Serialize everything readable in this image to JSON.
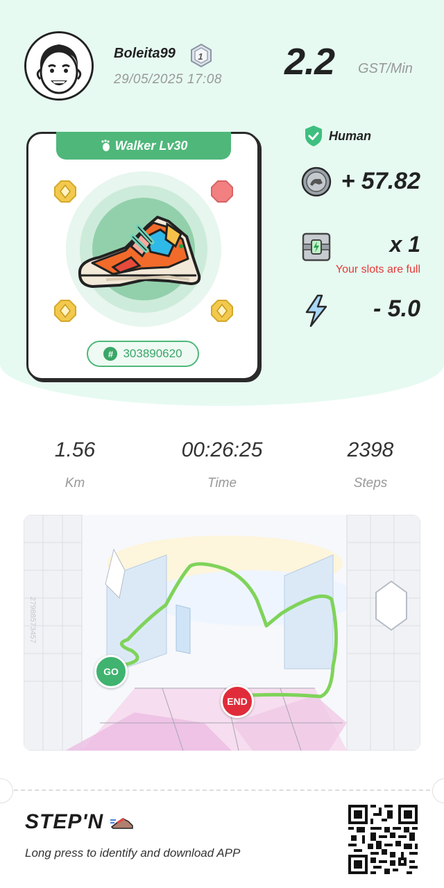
{
  "profile": {
    "username": "Boleita99",
    "datetime": "29/05/2025 17:08",
    "badge_icon": "level-badge-icon"
  },
  "earning_rate": {
    "value": "2.2",
    "unit": "GST/Min"
  },
  "sneaker": {
    "type_label": "Walker Lv30",
    "id": "303890620",
    "colors": {
      "header": "#4fb77a",
      "gem": "#f2c94c",
      "gem_empty": "#f28080"
    }
  },
  "rewards": {
    "mode_label": "Human",
    "gst_earned": "+ 57.82",
    "mystery_box_count": "x 1",
    "slots_message": "Your slots are full",
    "energy_spent": "- 5.0"
  },
  "stats": [
    {
      "value": "1.56",
      "label": "Km"
    },
    {
      "value": "00:26:25",
      "label": "Time"
    },
    {
      "value": "2398",
      "label": "Steps"
    }
  ],
  "map": {
    "start_label": "GO",
    "end_label": "END",
    "side_text": "2798857345​7"
  },
  "footer": {
    "brand": "STEP'N",
    "text": "Long press to identify and download APP"
  }
}
